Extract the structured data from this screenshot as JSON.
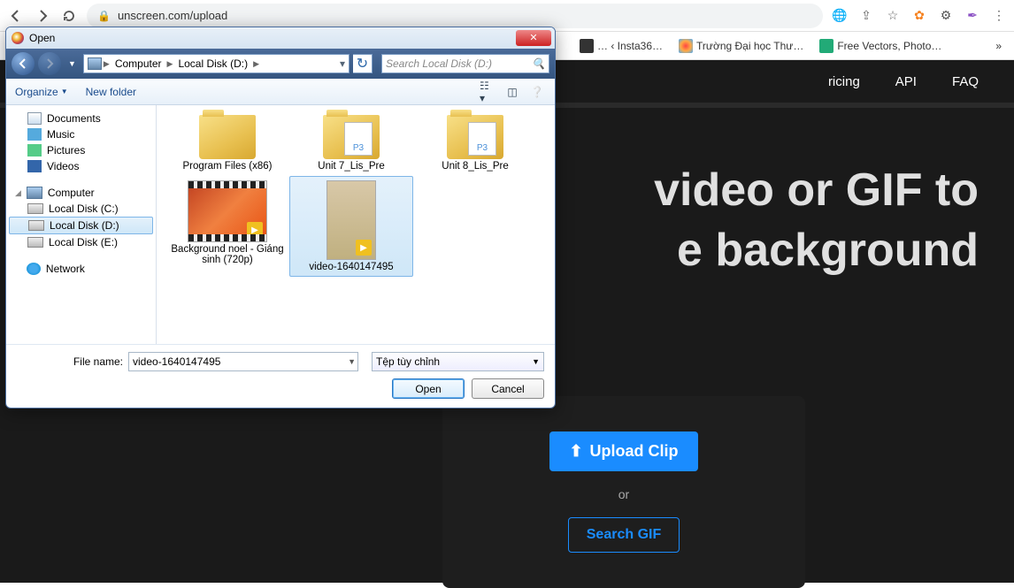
{
  "browser": {
    "url": "unscreen.com/upload",
    "right_icons": [
      "translate-icon",
      "share-icon",
      "star-icon",
      "ext-carrot-icon",
      "ext-gear-icon",
      "ext-feather-icon",
      "menu-icon"
    ]
  },
  "bookmarks": [
    {
      "label": "… ‹ Insta36…"
    },
    {
      "label": "Trường Đại học Thư…"
    },
    {
      "label": "Free Vectors, Photo…"
    }
  ],
  "page": {
    "nav": {
      "pricing": "ricing",
      "api": "API",
      "faq": "FAQ"
    },
    "hero_line1": "video or GIF to",
    "hero_line2": "e background",
    "upload_btn": "Upload Clip",
    "or_text": "or",
    "search_btn": "Search GIF"
  },
  "dialog": {
    "title": "Open",
    "breadcrumb": [
      "Computer",
      "Local Disk (D:)"
    ],
    "search_placeholder": "Search Local Disk (D:)",
    "toolbar": {
      "organize": "Organize",
      "newfolder": "New folder"
    },
    "libraries": [
      {
        "label": "Documents",
        "icon": "ico-doc"
      },
      {
        "label": "Music",
        "icon": "ico-music"
      },
      {
        "label": "Pictures",
        "icon": "ico-pic"
      },
      {
        "label": "Videos",
        "icon": "ico-vid"
      }
    ],
    "computer_label": "Computer",
    "disks": [
      {
        "label": "Local Disk (C:)"
      },
      {
        "label": "Local Disk (D:)"
      },
      {
        "label": "Local Disk (E:)"
      }
    ],
    "selected_disk": "Local Disk (D:)",
    "network_label": "Network",
    "files": [
      {
        "type": "folder",
        "label": "Program Files (x86)"
      },
      {
        "type": "folder-mp3",
        "label": "Unit 7_Lis_Pre"
      },
      {
        "type": "folder-mp3",
        "label": "Unit 8_Lis_Pre"
      },
      {
        "type": "video1",
        "label": "Background noel - Giáng sinh (720p)"
      },
      {
        "type": "video2",
        "label": "video-1640147495"
      }
    ],
    "selected_file": "video-1640147495",
    "filename_label": "File name:",
    "filename_value": "video-1640147495",
    "filetype_label": "Tệp tùy chỉnh",
    "open_btn": "Open",
    "cancel_btn": "Cancel"
  }
}
